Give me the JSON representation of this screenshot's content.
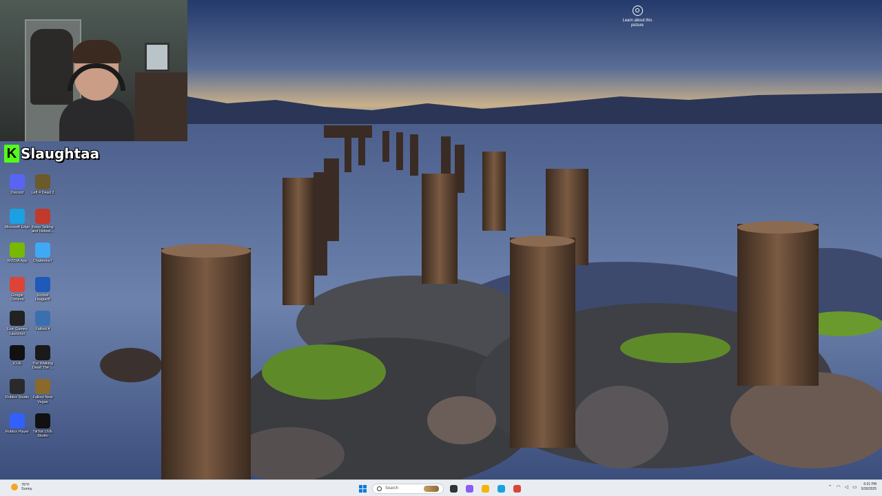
{
  "overlay": {
    "streamer_name": "Slaughtaa",
    "platform_icon": "kick-logo-icon",
    "accent_color": "#53fc18"
  },
  "desktop": {
    "spotlight_label": "Learn about this picture",
    "icons": [
      {
        "label": "Discord",
        "icon": "discord-icon",
        "color": "#5865f2"
      },
      {
        "label": "Left 4 Dead 2",
        "icon": "left4dead2-icon",
        "color": "#6b5a2a"
      },
      {
        "label": "Microsoft Edge",
        "icon": "edge-icon",
        "color": "#1ba1e2"
      },
      {
        "label": "Keep Talking and Nobod...",
        "icon": "keep-talking-icon",
        "color": "#c0392b"
      },
      {
        "label": "NVIDIA App",
        "icon": "nvidia-icon",
        "color": "#76b900"
      },
      {
        "label": "Chatterino7",
        "icon": "chatterino-icon",
        "color": "#3fa9f5"
      },
      {
        "label": "Google Chrome",
        "icon": "chrome-icon",
        "color": "#db4437"
      },
      {
        "label": "Rocket League®",
        "icon": "rocket-league-icon",
        "color": "#1e5ab8"
      },
      {
        "label": "Epic Games Launcher",
        "icon": "epic-games-icon",
        "color": "#222222"
      },
      {
        "label": "Fallout 4",
        "icon": "fallout4-icon",
        "color": "#3b6fb0"
      },
      {
        "label": "iCUE",
        "icon": "icue-icon",
        "color": "#111111"
      },
      {
        "label": "The Walking Dead The ...",
        "icon": "walking-dead-icon",
        "color": "#1a1a1a"
      },
      {
        "label": "Roblox Studio",
        "icon": "roblox-studio-icon",
        "color": "#2a2a2a"
      },
      {
        "label": "Fallout New Vegas",
        "icon": "fallout-nv-icon",
        "color": "#8a6a2a"
      },
      {
        "label": "Roblox Player",
        "icon": "roblox-player-icon",
        "color": "#335fff"
      },
      {
        "label": "TikTok LIVE Studio",
        "icon": "tiktok-live-icon",
        "color": "#111111"
      }
    ]
  },
  "taskbar": {
    "weather_temp": "76°F",
    "weather_desc": "Sunny",
    "search_placeholder": "Search",
    "clock_time": "6:31 PM",
    "clock_date": "5/30/2025",
    "pinned": [
      {
        "name": "task-view-icon",
        "color": "#333333"
      },
      {
        "name": "copilot-icon",
        "color": "#8a5cf6"
      },
      {
        "name": "file-explorer-icon",
        "color": "#f4b400"
      },
      {
        "name": "edge-taskbar-icon",
        "color": "#1ba1e2"
      },
      {
        "name": "chrome-taskbar-icon",
        "color": "#db4437"
      }
    ]
  }
}
